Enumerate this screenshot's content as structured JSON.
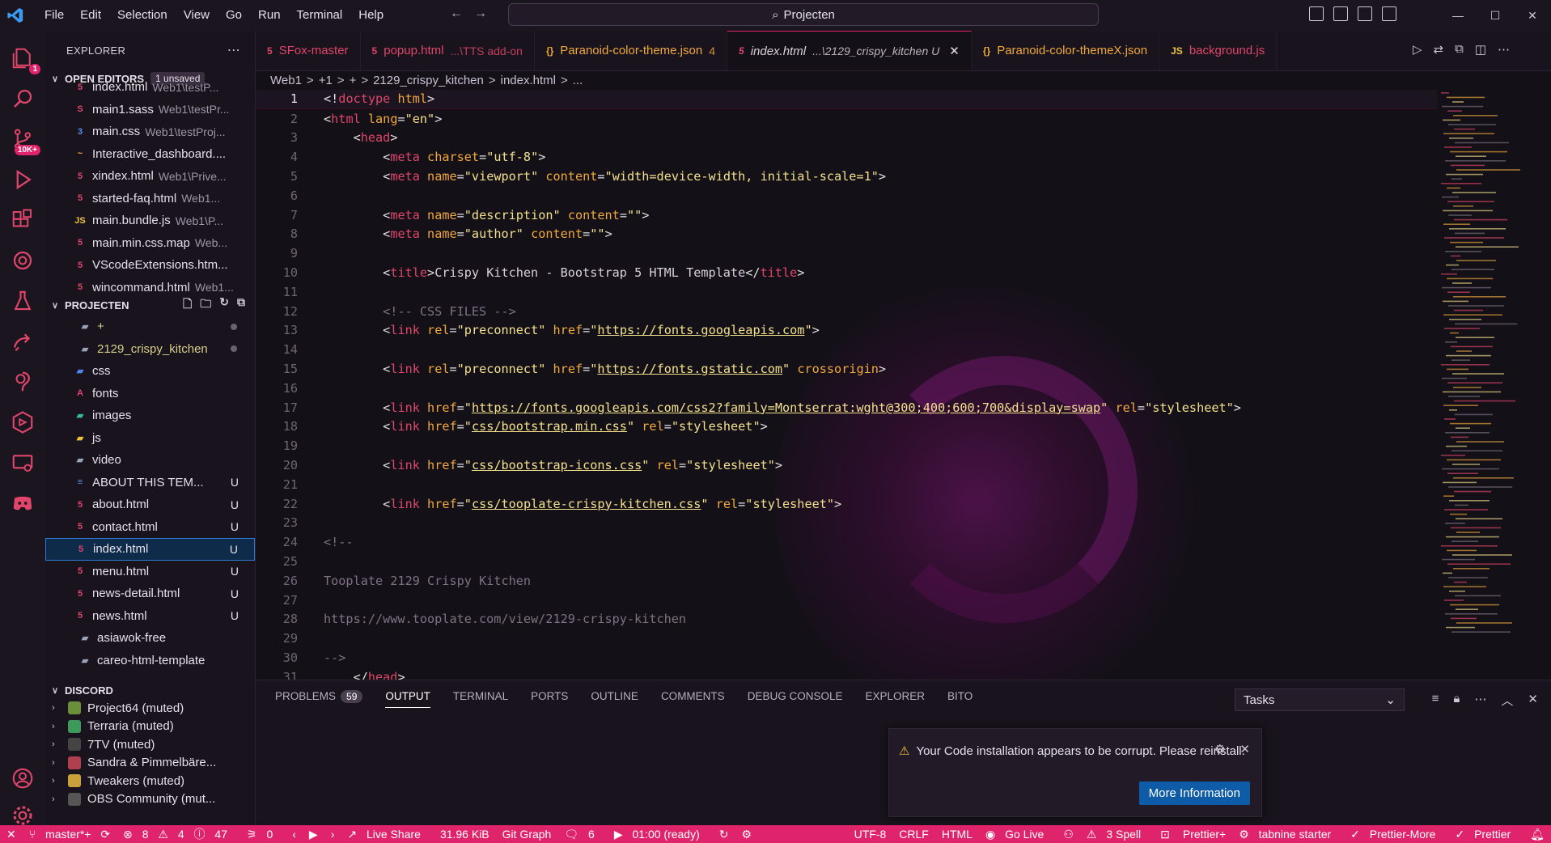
{
  "menu": [
    "File",
    "Edit",
    "Selection",
    "View",
    "Go",
    "Run",
    "Terminal",
    "Help"
  ],
  "search": {
    "label": "Projecten"
  },
  "explorer": {
    "title": "EXPLORER"
  },
  "open_editors": {
    "title": "OPEN EDITORS",
    "unsaved": "1 unsaved",
    "items": [
      {
        "name": "index.html",
        "path": "Web1\\testP..."
      },
      {
        "name": "main1.sass",
        "path": "Web1\\testPr..."
      },
      {
        "name": "main.css",
        "path": "Web1\\testProj..."
      },
      {
        "name": "Interactive_dashboard....",
        "path": ""
      },
      {
        "name": "xindex.html",
        "path": "Web1\\Prive..."
      },
      {
        "name": "started-faq.html",
        "path": "Web1..."
      },
      {
        "name": "main.bundle.js",
        "path": "Web1\\P..."
      },
      {
        "name": "main.min.css.map",
        "path": "Web..."
      },
      {
        "name": "VScodeExtensions.htm...",
        "path": ""
      },
      {
        "name": "wincommand.html",
        "path": "Web1..."
      }
    ]
  },
  "projecten": {
    "title": "PROJECTEN",
    "items": [
      {
        "name": "+",
        "type": "folder",
        "level": 1
      },
      {
        "name": "2129_crispy_kitchen",
        "type": "folder",
        "level": 1
      },
      {
        "name": "css",
        "type": "css-folder",
        "level": 2
      },
      {
        "name": "fonts",
        "type": "font-folder",
        "level": 2
      },
      {
        "name": "images",
        "type": "img-folder",
        "level": 2
      },
      {
        "name": "js",
        "type": "js-folder",
        "level": 2
      },
      {
        "name": "video",
        "type": "folder",
        "level": 2
      },
      {
        "name": "ABOUT THIS TEM...",
        "type": "doc",
        "level": 2,
        "status": "U"
      },
      {
        "name": "about.html",
        "type": "html",
        "level": 2,
        "status": "U"
      },
      {
        "name": "contact.html",
        "type": "html",
        "level": 2,
        "status": "U"
      },
      {
        "name": "index.html",
        "type": "html",
        "level": 2,
        "status": "U"
      },
      {
        "name": "menu.html",
        "type": "html",
        "level": 2,
        "status": "U"
      },
      {
        "name": "news-detail.html",
        "type": "html",
        "level": 2,
        "status": "U"
      },
      {
        "name": "news.html",
        "type": "html",
        "level": 2,
        "status": "U"
      },
      {
        "name": "asiawok-free",
        "type": "folder",
        "level": 1
      },
      {
        "name": "careo-html-template",
        "type": "folder",
        "level": 1
      }
    ]
  },
  "discord": {
    "title": "DISCORD",
    "items": [
      "Project64 (muted)",
      "Terraria (muted)",
      "7TV (muted)",
      "Sandra & Pimmelbäre...",
      "Tweakers (muted)",
      "OBS Community (mut..."
    ]
  },
  "tabs": [
    {
      "label": "SFox-master",
      "kind": "html",
      "extra": ""
    },
    {
      "label": "popup.html",
      "kind": "html",
      "extra": "...\\TTS add-on"
    },
    {
      "label": "Paranoid-color-theme.json",
      "kind": "json",
      "extra": "4"
    },
    {
      "label": "index.html",
      "kind": "html",
      "extra": "...\\2129_crispy_kitchen  U"
    },
    {
      "label": "Paranoid-color-themeX.json",
      "kind": "json",
      "extra": ""
    },
    {
      "label": "background.js",
      "kind": "js",
      "extra": ""
    }
  ],
  "breadcrumb": [
    "Web1",
    ">",
    "+1",
    ">",
    "+",
    ">",
    "2129_crispy_kitchen",
    ">",
    "index.html",
    ">",
    "..."
  ],
  "code_lines": [
    {
      "n": "1",
      "segs": [
        [
          "br",
          "<!"
        ],
        [
          "tag",
          "doctype"
        ],
        [
          "tx",
          " "
        ],
        [
          "at",
          "html"
        ],
        [
          "br",
          ">"
        ]
      ]
    },
    {
      "n": "2",
      "segs": [
        [
          "br",
          "<"
        ],
        [
          "tag",
          "html"
        ],
        [
          "tx",
          " "
        ],
        [
          "at",
          "lang"
        ],
        [
          "br",
          "="
        ],
        [
          "st",
          "\"en\""
        ],
        [
          "br",
          ">"
        ]
      ]
    },
    {
      "n": "3",
      "segs": [
        [
          "tx",
          "    "
        ],
        [
          "br",
          "<"
        ],
        [
          "tag",
          "head"
        ],
        [
          "br",
          ">"
        ]
      ]
    },
    {
      "n": "4",
      "segs": [
        [
          "tx",
          "        "
        ],
        [
          "br",
          "<"
        ],
        [
          "tag",
          "meta"
        ],
        [
          "tx",
          " "
        ],
        [
          "at",
          "charset"
        ],
        [
          "br",
          "="
        ],
        [
          "st",
          "\"utf-8\""
        ],
        [
          "br",
          ">"
        ]
      ]
    },
    {
      "n": "5",
      "segs": [
        [
          "tx",
          "        "
        ],
        [
          "br",
          "<"
        ],
        [
          "tag",
          "meta"
        ],
        [
          "tx",
          " "
        ],
        [
          "at",
          "name"
        ],
        [
          "br",
          "="
        ],
        [
          "st",
          "\"viewport\""
        ],
        [
          "tx",
          " "
        ],
        [
          "at",
          "content"
        ],
        [
          "br",
          "="
        ],
        [
          "st",
          "\"width=device-width, initial-scale=1\""
        ],
        [
          "br",
          ">"
        ]
      ]
    },
    {
      "n": "6",
      "segs": []
    },
    {
      "n": "7",
      "segs": [
        [
          "tx",
          "        "
        ],
        [
          "br",
          "<"
        ],
        [
          "tag",
          "meta"
        ],
        [
          "tx",
          " "
        ],
        [
          "at",
          "name"
        ],
        [
          "br",
          "="
        ],
        [
          "st",
          "\"description\""
        ],
        [
          "tx",
          " "
        ],
        [
          "at",
          "content"
        ],
        [
          "br",
          "="
        ],
        [
          "st",
          "\"\""
        ],
        [
          "br",
          ">"
        ]
      ]
    },
    {
      "n": "8",
      "segs": [
        [
          "tx",
          "        "
        ],
        [
          "br",
          "<"
        ],
        [
          "tag",
          "meta"
        ],
        [
          "tx",
          " "
        ],
        [
          "at",
          "name"
        ],
        [
          "br",
          "="
        ],
        [
          "st",
          "\"author\""
        ],
        [
          "tx",
          " "
        ],
        [
          "at",
          "content"
        ],
        [
          "br",
          "="
        ],
        [
          "st",
          "\"\""
        ],
        [
          "br",
          ">"
        ]
      ]
    },
    {
      "n": "9",
      "segs": []
    },
    {
      "n": "10",
      "segs": [
        [
          "tx",
          "        "
        ],
        [
          "br",
          "<"
        ],
        [
          "tag",
          "title"
        ],
        [
          "br",
          ">"
        ],
        [
          "tx",
          "Crispy Kitchen - Bootstrap 5 HTML Template"
        ],
        [
          "br",
          "</"
        ],
        [
          "tag",
          "title"
        ],
        [
          "br",
          ">"
        ]
      ]
    },
    {
      "n": "11",
      "segs": []
    },
    {
      "n": "12",
      "segs": [
        [
          "tx",
          "        "
        ],
        [
          "cm",
          "<!-- CSS FILES -->"
        ]
      ]
    },
    {
      "n": "13",
      "segs": [
        [
          "tx",
          "        "
        ],
        [
          "br",
          "<"
        ],
        [
          "tag",
          "link"
        ],
        [
          "tx",
          " "
        ],
        [
          "at",
          "rel"
        ],
        [
          "br",
          "="
        ],
        [
          "st",
          "\"preconnect\""
        ],
        [
          "tx",
          " "
        ],
        [
          "at",
          "href"
        ],
        [
          "br",
          "="
        ],
        [
          "st",
          "\""
        ],
        [
          "url",
          "https://fonts.googleapis.com"
        ],
        [
          "st",
          "\""
        ],
        [
          "br",
          ">"
        ]
      ]
    },
    {
      "n": "14",
      "segs": []
    },
    {
      "n": "15",
      "segs": [
        [
          "tx",
          "        "
        ],
        [
          "br",
          "<"
        ],
        [
          "tag",
          "link"
        ],
        [
          "tx",
          " "
        ],
        [
          "at",
          "rel"
        ],
        [
          "br",
          "="
        ],
        [
          "st",
          "\"preconnect\""
        ],
        [
          "tx",
          " "
        ],
        [
          "at",
          "href"
        ],
        [
          "br",
          "="
        ],
        [
          "st",
          "\""
        ],
        [
          "url",
          "https://fonts.gstatic.com"
        ],
        [
          "st",
          "\""
        ],
        [
          "tx",
          " "
        ],
        [
          "at",
          "crossorigin"
        ],
        [
          "br",
          ">"
        ]
      ]
    },
    {
      "n": "16",
      "segs": []
    },
    {
      "n": "17",
      "segs": [
        [
          "tx",
          "        "
        ],
        [
          "br",
          "<"
        ],
        [
          "tag",
          "link"
        ],
        [
          "tx",
          " "
        ],
        [
          "at",
          "href"
        ],
        [
          "br",
          "="
        ],
        [
          "st",
          "\""
        ],
        [
          "url",
          "https://fonts.googleapis.com/css2?family=Montserrat:wght@300;400;600;700&display=swap"
        ],
        [
          "st",
          "\""
        ],
        [
          "tx",
          " "
        ],
        [
          "at",
          "rel"
        ],
        [
          "br",
          "="
        ],
        [
          "st",
          "\"stylesheet\""
        ],
        [
          "br",
          ">"
        ]
      ]
    },
    {
      "n": "18",
      "segs": [
        [
          "tx",
          "        "
        ],
        [
          "br",
          "<"
        ],
        [
          "tag",
          "link"
        ],
        [
          "tx",
          " "
        ],
        [
          "at",
          "href"
        ],
        [
          "br",
          "="
        ],
        [
          "st",
          "\""
        ],
        [
          "url",
          "css/bootstrap.min.css"
        ],
        [
          "st",
          "\""
        ],
        [
          "tx",
          " "
        ],
        [
          "at",
          "rel"
        ],
        [
          "br",
          "="
        ],
        [
          "st",
          "\"stylesheet\""
        ],
        [
          "br",
          ">"
        ]
      ]
    },
    {
      "n": "19",
      "segs": []
    },
    {
      "n": "20",
      "segs": [
        [
          "tx",
          "        "
        ],
        [
          "br",
          "<"
        ],
        [
          "tag",
          "link"
        ],
        [
          "tx",
          " "
        ],
        [
          "at",
          "href"
        ],
        [
          "br",
          "="
        ],
        [
          "st",
          "\""
        ],
        [
          "url",
          "css/bootstrap-icons.css"
        ],
        [
          "st",
          "\""
        ],
        [
          "tx",
          " "
        ],
        [
          "at",
          "rel"
        ],
        [
          "br",
          "="
        ],
        [
          "st",
          "\"stylesheet\""
        ],
        [
          "br",
          ">"
        ]
      ]
    },
    {
      "n": "21",
      "segs": []
    },
    {
      "n": "22",
      "segs": [
        [
          "tx",
          "        "
        ],
        [
          "br",
          "<"
        ],
        [
          "tag",
          "link"
        ],
        [
          "tx",
          " "
        ],
        [
          "at",
          "href"
        ],
        [
          "br",
          "="
        ],
        [
          "st",
          "\""
        ],
        [
          "url",
          "css/tooplate-crispy-kitchen.css"
        ],
        [
          "st",
          "\""
        ],
        [
          "tx",
          " "
        ],
        [
          "at",
          "rel"
        ],
        [
          "br",
          "="
        ],
        [
          "st",
          "\"stylesheet\""
        ],
        [
          "br",
          ">"
        ]
      ]
    },
    {
      "n": "23",
      "segs": []
    },
    {
      "n": "24",
      "segs": [
        [
          "cm",
          "<!--"
        ]
      ]
    },
    {
      "n": "25",
      "segs": []
    },
    {
      "n": "26",
      "segs": [
        [
          "cm",
          "Tooplate 2129 Crispy Kitchen"
        ]
      ]
    },
    {
      "n": "27",
      "segs": []
    },
    {
      "n": "28",
      "segs": [
        [
          "cm",
          "https://www.tooplate.com/view/2129-crispy-kitchen"
        ]
      ]
    },
    {
      "n": "29",
      "segs": []
    },
    {
      "n": "30",
      "segs": [
        [
          "cm",
          "-->"
        ]
      ]
    },
    {
      "n": "31",
      "segs": [
        [
          "tx",
          "    "
        ],
        [
          "br",
          "</"
        ],
        [
          "tag",
          "head"
        ],
        [
          "br",
          ">"
        ]
      ]
    }
  ],
  "panel": {
    "tabs": [
      "PROBLEMS",
      "OUTPUT",
      "TERMINAL",
      "PORTS",
      "OUTLINE",
      "COMMENTS",
      "DEBUG CONSOLE",
      "EXPLORER",
      "BITO"
    ],
    "problems_count": "59",
    "active": "OUTPUT",
    "tasks_select": "Tasks"
  },
  "toast": {
    "message": "Your Code installation appears to be corrupt. Please reinstall.",
    "button": "More Information"
  },
  "activity_badges": {
    "explorer": "1",
    "scm": "10K+"
  },
  "statusbar": {
    "branch": "master*+",
    "errors": "8",
    "warnings": "4",
    "info": "47",
    "ports": "0",
    "liveshare": "Live Share",
    "size": "31.96 KiB",
    "gitgraph": "Git Graph",
    "comments": "6",
    "timer": "01:00 (ready)",
    "encoding": "UTF-8",
    "eol": "CRLF",
    "lang": "HTML",
    "golive": "Go Live",
    "spell": "3 Spell",
    "prettierplus": "Prettier+",
    "tabnine": "tabnine starter",
    "prettiermore": "Prettier-More",
    "prettier": "Prettier"
  },
  "colors": {
    "accent": "#e0246c",
    "tag": "#e0466a",
    "attr": "#f0a93c",
    "string": "#f3e18c",
    "comment": "#7d7282",
    "selection": "#0e2b4a"
  }
}
